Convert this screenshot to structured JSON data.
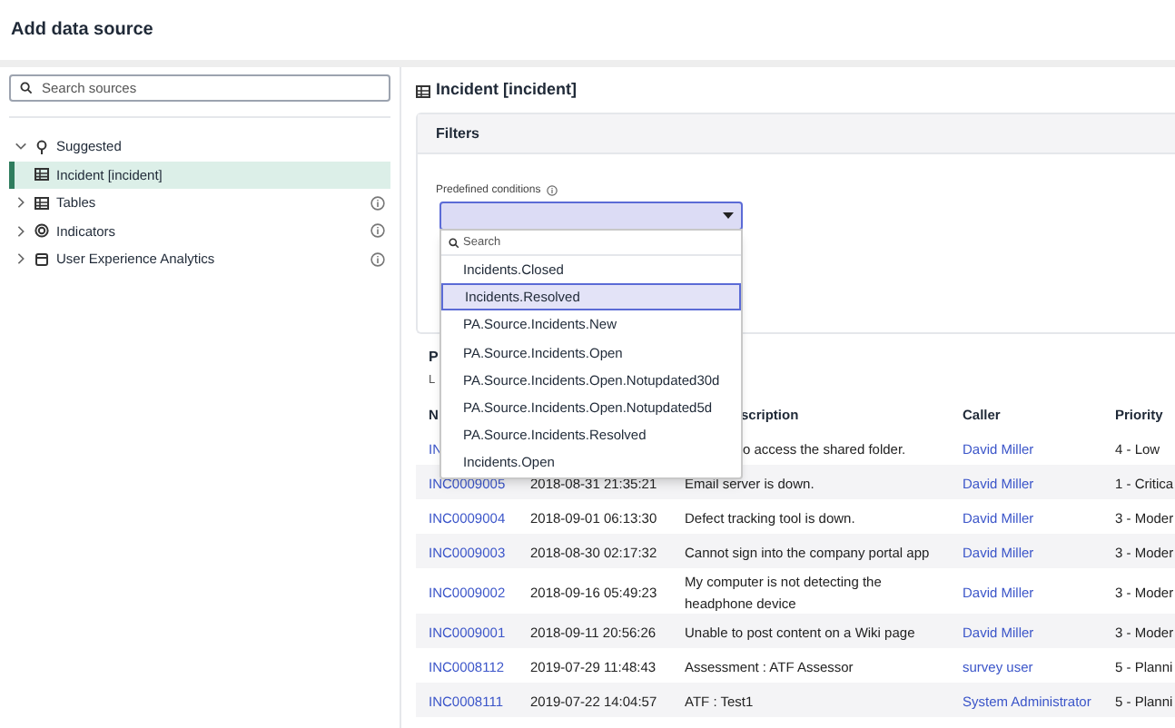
{
  "header": {
    "title": "Add data source"
  },
  "sidebar": {
    "search": {
      "placeholder": "Search sources"
    },
    "tree": [
      {
        "label": "Suggested",
        "kind": "pin",
        "expanded": true,
        "selected": false,
        "info": false,
        "children": [
          {
            "label": "Incident [incident]",
            "kind": "table",
            "selected": true
          }
        ]
      },
      {
        "label": "Tables",
        "kind": "table",
        "expanded": false,
        "selected": false,
        "info": true
      },
      {
        "label": "Indicators",
        "kind": "gauge",
        "expanded": false,
        "selected": false,
        "info": true
      },
      {
        "label": "User Experience Analytics",
        "kind": "box",
        "expanded": false,
        "selected": false,
        "info": true
      }
    ]
  },
  "main": {
    "title": "Incident [incident]",
    "filters": {
      "title": "Filters",
      "label": "Predefined conditions",
      "dropdown": {
        "search_placeholder": "Search",
        "options": [
          {
            "label": "Incidents.Closed",
            "selected": false
          },
          {
            "label": "Incidents.Resolved",
            "selected": true
          },
          {
            "label": "PA.Source.Incidents.New",
            "selected": false
          },
          {
            "label": "PA.Source.Incidents.Open",
            "selected": false
          },
          {
            "label": "PA.Source.Incidents.Open.Notupdated30d",
            "selected": false
          },
          {
            "label": "PA.Source.Incidents.Open.Notupdated5d",
            "selected": false
          },
          {
            "label": "PA.Source.Incidents.Resolved",
            "selected": false
          },
          {
            "label": "Incidents.Open",
            "selected": false
          }
        ]
      }
    },
    "preview_title": "P",
    "preview_subtitle": "L",
    "table": {
      "columns": [
        {
          "label": "N"
        },
        {
          "label": "scription"
        },
        {
          "label": "Caller"
        },
        {
          "label": "Priority"
        }
      ],
      "rows": [
        {
          "number": "IN",
          "description": "o access the shared folder.",
          "caller": "David Miller",
          "priority": "4 - Low"
        },
        {
          "number": "INC0009005",
          "opened": "2018-08-31 21:35:21",
          "description": "Email server is down.",
          "caller": "David Miller",
          "priority": "1 - Critica"
        },
        {
          "number": "INC0009004",
          "opened": "2018-09-01 06:13:30",
          "description": "Defect tracking tool is down.",
          "caller": "David Miller",
          "priority": "3 - Moder"
        },
        {
          "number": "INC0009003",
          "opened": "2018-08-30 02:17:32",
          "description": "Cannot sign into the company portal app",
          "caller": "David Miller",
          "priority": "3 - Moder"
        },
        {
          "number": "INC0009002",
          "opened": "2018-09-16 05:49:23",
          "description": "My computer is not detecting the headphone device",
          "caller": "David Miller",
          "priority": "3 - Moder"
        },
        {
          "number": "INC0009001",
          "opened": "2018-09-11 20:56:26",
          "description": "Unable to post content on a Wiki page",
          "caller": "David Miller",
          "priority": "3 - Moder"
        },
        {
          "number": "INC0008112",
          "opened": "2019-07-29 11:48:43",
          "description": "Assessment : ATF Assessor",
          "caller": "survey user",
          "priority": "5 - Planni"
        },
        {
          "number": "INC0008111",
          "opened": "2019-07-22 14:04:57",
          "description": "ATF : Test1",
          "caller": "System Administrator",
          "priority": "5 - Planni"
        }
      ]
    }
  }
}
